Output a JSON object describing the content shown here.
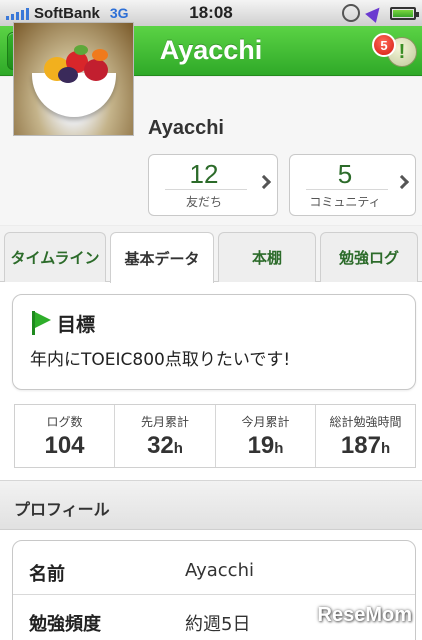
{
  "status_bar": {
    "carrier": "SoftBank",
    "network": "3G",
    "time": "18:08"
  },
  "header": {
    "title": "Ayacchi",
    "notification_count": "5",
    "notification_symbol": "!"
  },
  "profile": {
    "name": "Ayacchi",
    "stats": [
      {
        "value": "12",
        "label": "友だち"
      },
      {
        "value": "5",
        "label": "コミュニティ"
      }
    ]
  },
  "tabs": [
    {
      "label": "タイムライン",
      "active": false
    },
    {
      "label": "基本データ",
      "active": true
    },
    {
      "label": "本棚",
      "active": false
    },
    {
      "label": "勉強ログ",
      "active": false
    }
  ],
  "goal": {
    "title": "目標",
    "text": "年内にTOEIC800点取りたいです!"
  },
  "logs": [
    {
      "label": "ログ数",
      "value": "104",
      "unit": ""
    },
    {
      "label": "先月累計",
      "value": "32",
      "unit": "h"
    },
    {
      "label": "今月累計",
      "value": "19",
      "unit": "h"
    },
    {
      "label": "総計勉強時間",
      "value": "187",
      "unit": "h"
    }
  ],
  "profile_section": {
    "title": "プロフィール",
    "rows": [
      {
        "key": "名前",
        "value": "Ayacchi"
      },
      {
        "key": "勉強頻度",
        "value": "約週5日"
      }
    ]
  },
  "watermark": "ReseMom",
  "colors": {
    "brand_green": "#3cbf33",
    "badge_red": "#d31b10",
    "stat_green": "#2c6b2a"
  },
  "icons": {
    "menu": "hamburger-icon",
    "notification": "exclamation-icon",
    "goal": "flag-icon",
    "chevron": "chevron-right-icon"
  }
}
